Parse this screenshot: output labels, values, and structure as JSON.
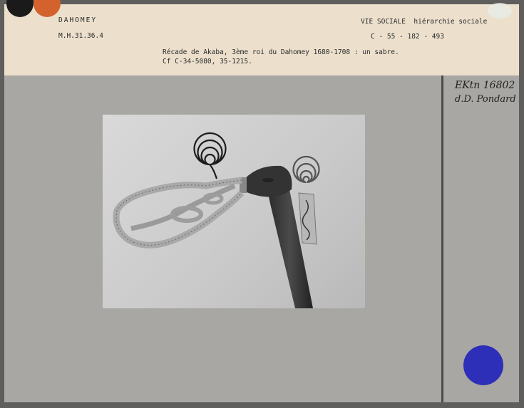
{
  "header": {
    "left_title": "DAHOMEY",
    "left_ref": "M.H.31.36.4",
    "right_title": "VIE SOCIALE",
    "right_subtitle": "hiérarchie sociale",
    "right_ref": "C - 55 - 182 - 493",
    "description_line1": "Récade de Akaba, 3ème roi du Dahomey 1680-1708 : un sabre.",
    "description_line2": "Cf C-34-5080,   35-1215."
  },
  "annotation": {
    "line1": "EKtn 16802",
    "line2": "d.D. Pondard"
  },
  "colors": {
    "header_bg": "#ece0cd",
    "card_bg": "#a8a7a3",
    "dot_black": "#1a1a1a",
    "dot_orange": "#d4622d",
    "dot_blue": "#2d2fb8"
  },
  "photo": {
    "subject": "recade-sabre"
  }
}
